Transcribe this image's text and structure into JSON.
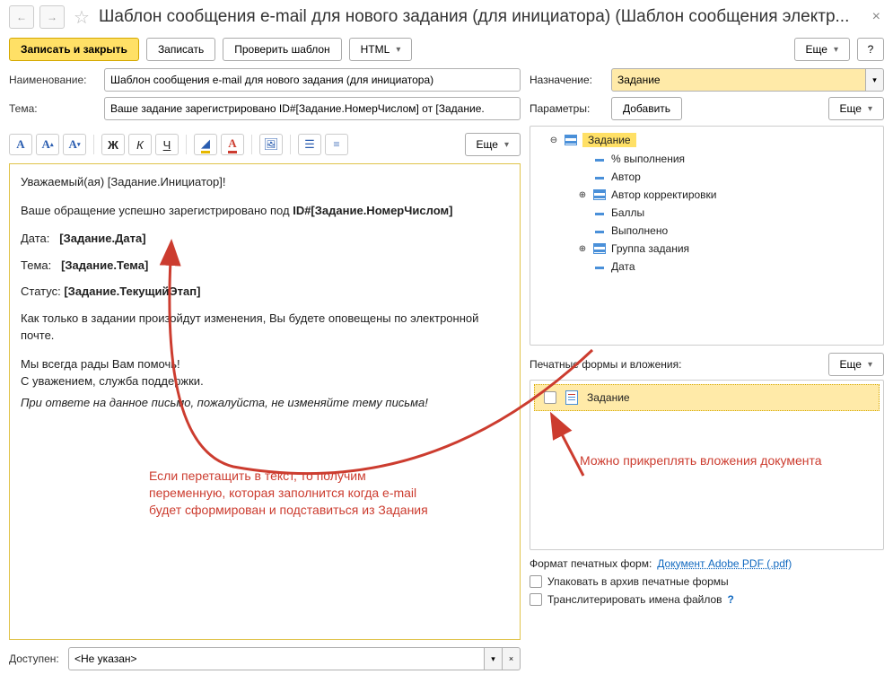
{
  "header": {
    "title": "Шаблон сообщения e-mail для нового задания (для инициатора) (Шаблон сообщения электр..."
  },
  "toolbar": {
    "save_close": "Записать и закрыть",
    "save": "Записать",
    "check_template": "Проверить шаблон",
    "html": "HTML",
    "more": "Еще",
    "help": "?"
  },
  "left": {
    "name_label": "Наименование:",
    "name_value": "Шаблон сообщения e-mail для нового задания (для инициатора)",
    "subject_label": "Тема:",
    "subject_value": "Ваше задание зарегистрировано ID#[Задание.НомерЧислом] от [Задание.",
    "editor_more": "Еще",
    "body": {
      "greeting": "Уважаемый(ая) [Задание.Инициатор]!",
      "registered_pre": "Ваше обращение успешно зарегистрировано под ",
      "registered_id": "ID#[Задание.НомерЧислом]",
      "date_label": "Дата:",
      "date_value": "[Задание.Дата]",
      "topic_label": "Тема:",
      "topic_value": "[Задание.Тема]",
      "status_label": "Статус:",
      "status_value": "[Задание.ТекущийЭтап]",
      "notify": "Как только в задании произойдут изменения, Вы будете оповещены по электронной почте.",
      "glad": "Мы всегда рады Вам помочь!",
      "sign": "С уважением, служба поддержки.",
      "footer": "При ответе на данное письмо, пожалуйста, не изменяйте тему письма!"
    },
    "avail_label": "Доступен:",
    "avail_value": "<Не указан>"
  },
  "right": {
    "purpose_label": "Назначение:",
    "purpose_value": "Задание",
    "params_label": "Параметры:",
    "add": "Добавить",
    "more": "Еще",
    "tree": {
      "root": "Задание",
      "items": [
        "% выполнения",
        "Автор",
        "Автор корректировки",
        "Баллы",
        "Выполнено",
        "Группа задания",
        "Дата"
      ]
    },
    "attach_label": "Печатные формы и вложения:",
    "attach_more": "Еще",
    "attach_item": "Задание",
    "format_label": "Формат печатных форм:",
    "format_link": "Документ Adobe PDF (.pdf)",
    "pack": "Упаковать в архив печатные формы",
    "translit": "Транслитерировать имена файлов"
  },
  "annotations": {
    "left_note": "Если перетащить в текст, то получим переменную, которая заполнится когда e-mail будет сформирован и подставиться из Задания",
    "right_note": "Можно прикреплять вложения документа"
  }
}
